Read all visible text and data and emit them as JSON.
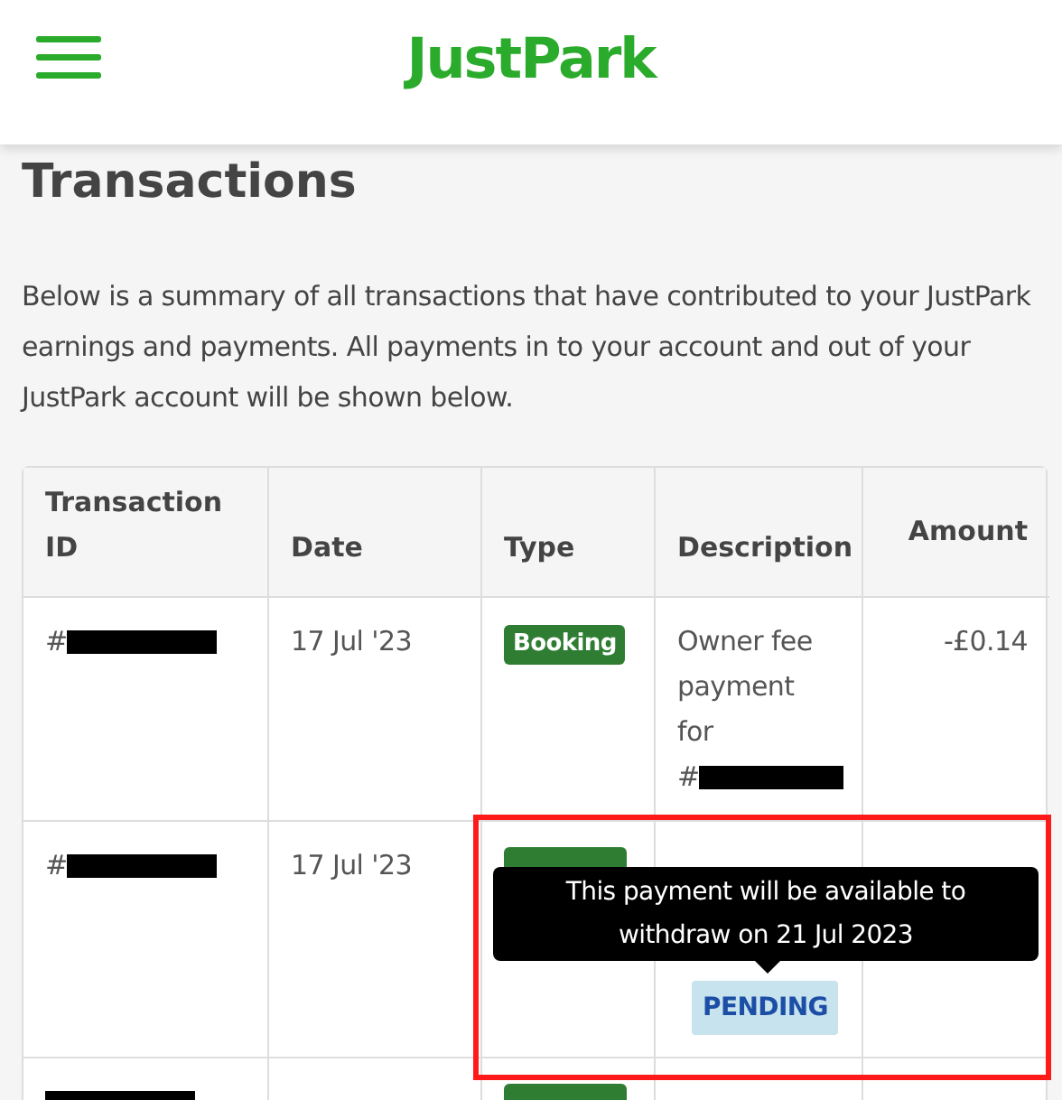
{
  "header": {
    "logo": "JustPark"
  },
  "title": "Transactions",
  "intro": "Below is a summary of all transactions that have contributed to your JustPark earnings and payments. All payments in to your account and out of your JustPark account will be shown below.",
  "table": {
    "columns": [
      "Transaction ID",
      "Date",
      "Type",
      "Description",
      "Amount"
    ],
    "rows": [
      {
        "kind": "full",
        "id_prefix": "#",
        "date": "17 Jul '23",
        "type": "Booking",
        "description": "Owner fee payment for",
        "description_ref_prefix": "#",
        "amount": "-£0.14"
      },
      {
        "kind": "covered",
        "id_prefix": "#",
        "date": "17 Jul '23",
        "status": "PENDING"
      },
      {
        "kind": "cut"
      }
    ]
  },
  "tooltip": {
    "text": "This payment will be available to withdraw on 21 Jul 2023"
  }
}
